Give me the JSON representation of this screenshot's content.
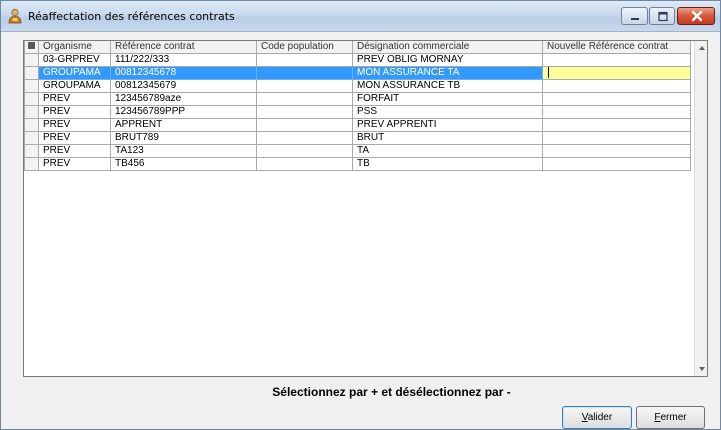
{
  "window": {
    "title": "Réaffectation des références contrats",
    "icon": "app-person-icon"
  },
  "colors": {
    "selection": "#3399ff",
    "edit_cell": "#ffff99",
    "close_button": "#c63b1f"
  },
  "grid": {
    "columns": [
      "Organisme",
      "Référence contrat",
      "Code population",
      "Désignation commerciale",
      "Nouvelle Référence contrat"
    ],
    "rows": [
      {
        "organisme": "03-GRPREV",
        "reference": "111/222/333",
        "code_population": "",
        "designation": "PREV OBLIG MORNAY",
        "nouvelle_reference": ""
      },
      {
        "organisme": "GROUPAMA",
        "reference": "00812345678",
        "code_population": "",
        "designation": "MON ASSURANCE TA",
        "nouvelle_reference": ""
      },
      {
        "organisme": "GROUPAMA",
        "reference": "00812345679",
        "code_population": "",
        "designation": "MON ASSURANCE TB",
        "nouvelle_reference": ""
      },
      {
        "organisme": "PREV",
        "reference": "123456789aze",
        "code_population": "",
        "designation": "FORFAIT",
        "nouvelle_reference": ""
      },
      {
        "organisme": "PREV",
        "reference": "123456789PPP",
        "code_population": "",
        "designation": "PSS",
        "nouvelle_reference": ""
      },
      {
        "organisme": "PREV",
        "reference": "APPRENT",
        "code_population": "",
        "designation": "PREV APPRENTI",
        "nouvelle_reference": ""
      },
      {
        "organisme": "PREV",
        "reference": "BRUT789",
        "code_population": "",
        "designation": "BRUT",
        "nouvelle_reference": ""
      },
      {
        "organisme": "PREV",
        "reference": "TA123",
        "code_population": "",
        "designation": "TA",
        "nouvelle_reference": ""
      },
      {
        "organisme": "PREV",
        "reference": "TB456",
        "code_population": "",
        "designation": "TB",
        "nouvelle_reference": ""
      }
    ],
    "selected_row_index": 1
  },
  "hint": "Sélectionnez par + et désélectionnez par -",
  "buttons": {
    "valider": {
      "mnemonic": "V",
      "rest": "alider"
    },
    "fermer": {
      "mnemonic": "F",
      "rest": "ermer"
    }
  }
}
